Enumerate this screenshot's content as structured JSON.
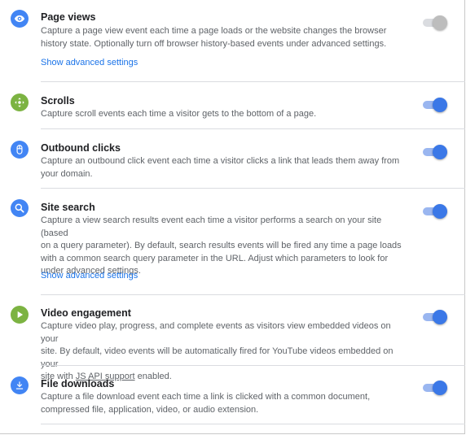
{
  "colors": {
    "primary_blue": "#4285f4",
    "green": "#7cb342",
    "toggle_on": "#3b78e7",
    "link": "#1a73e8"
  },
  "settings": [
    {
      "title": "Page views",
      "icon": "eye-icon",
      "description_lines": [
        "Capture a page view event each time a page loads or the website changes the browser",
        "history state. Optionally turn off browser history-based events under advanced settings."
      ],
      "link": "Show advanced settings",
      "enabled": false
    },
    {
      "title": "Scrolls",
      "icon": "scroll-icon",
      "description_lines": [
        "Capture scroll events each time a visitor gets to the bottom of a page."
      ],
      "enabled": true
    },
    {
      "title": "Outbound clicks",
      "icon": "mouse-icon",
      "description_lines": [
        "Capture an outbound click event each time a visitor clicks a link that leads them away from",
        "your domain."
      ],
      "enabled": true
    },
    {
      "title": "Site search",
      "icon": "search-icon",
      "description_lines": [
        "Capture a view search results event each time a visitor performs a search on your site (based",
        "on a query parameter). By default, search results events will be fired any time a page loads",
        "with a common search query parameter in the URL. Adjust which parameters to look for",
        "under advanced settings."
      ],
      "link": "Show advanced settings",
      "enabled": true
    },
    {
      "title": "Video engagement",
      "icon": "play-icon",
      "description_lines": [
        "Capture video play, progress, and complete events as visitors view embedded videos on your",
        "site. By default, video events will be automatically fired for YouTube videos embedded on your"
      ],
      "description_last_prefix": "site with ",
      "description_last_link": "JS API support",
      "description_last_suffix": " enabled.",
      "enabled": true
    },
    {
      "title": "File downloads",
      "icon": "download-icon",
      "description_lines": [
        "Capture a file download event each time a link is clicked with a common document,",
        "compressed file, application, video, or audio extension."
      ],
      "enabled": true
    }
  ]
}
